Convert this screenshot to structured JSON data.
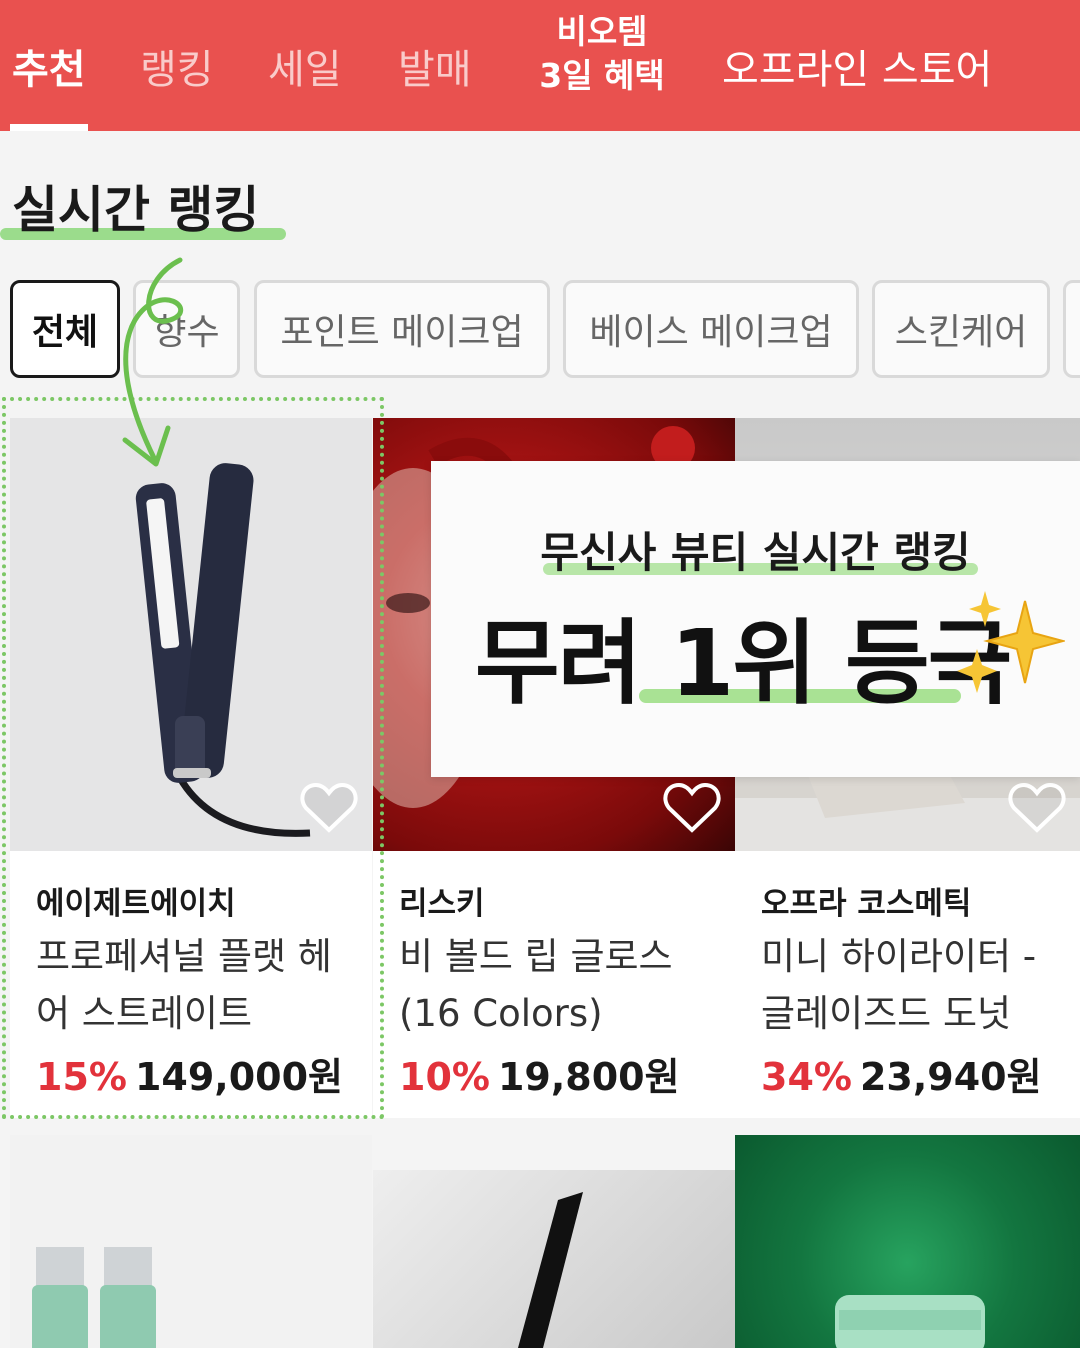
{
  "nav": {
    "tabs": [
      {
        "label": "추천"
      },
      {
        "label": "랭킹"
      },
      {
        "label": "세일"
      },
      {
        "label": "발매"
      },
      {
        "label_line1": "비오템",
        "label_line2": "3일 혜택"
      },
      {
        "label": "오프라인 스토어"
      }
    ],
    "active_index": 0
  },
  "section": {
    "title": "실시간 랭킹"
  },
  "filters": [
    {
      "label": "전체",
      "active": true
    },
    {
      "label": "향수",
      "active": false
    },
    {
      "label": "포인트 메이크업",
      "active": false
    },
    {
      "label": "베이스 메이크업",
      "active": false
    },
    {
      "label": "스킨케어",
      "active": false
    }
  ],
  "banner": {
    "subtitle": "무신사 뷰티 실시간 랭킹",
    "headline": "무려 1위 등극"
  },
  "products": [
    {
      "brand": "에이제트에이치",
      "name": "프로페셔널 플랫 헤어 스트레이트",
      "discount": "15%",
      "price": "149,000원",
      "liked": false
    },
    {
      "brand": "리스키",
      "name": "비 볼드 립 글로스 (16 Colors)",
      "discount": "10%",
      "price": "19,800원",
      "liked": false
    },
    {
      "brand": "오프라 코스메틱",
      "name": "미니 하이라이터 - 글레이즈드 도넛",
      "discount": "34%",
      "price": "23,940원",
      "liked": false
    }
  ],
  "colors": {
    "nav_bg": "#e9514f",
    "discount": "#e2323b",
    "annotation_green": "#7cc765"
  },
  "icons": [
    "heart-outline-icon",
    "sparkles-icon",
    "arrow-icon"
  ]
}
